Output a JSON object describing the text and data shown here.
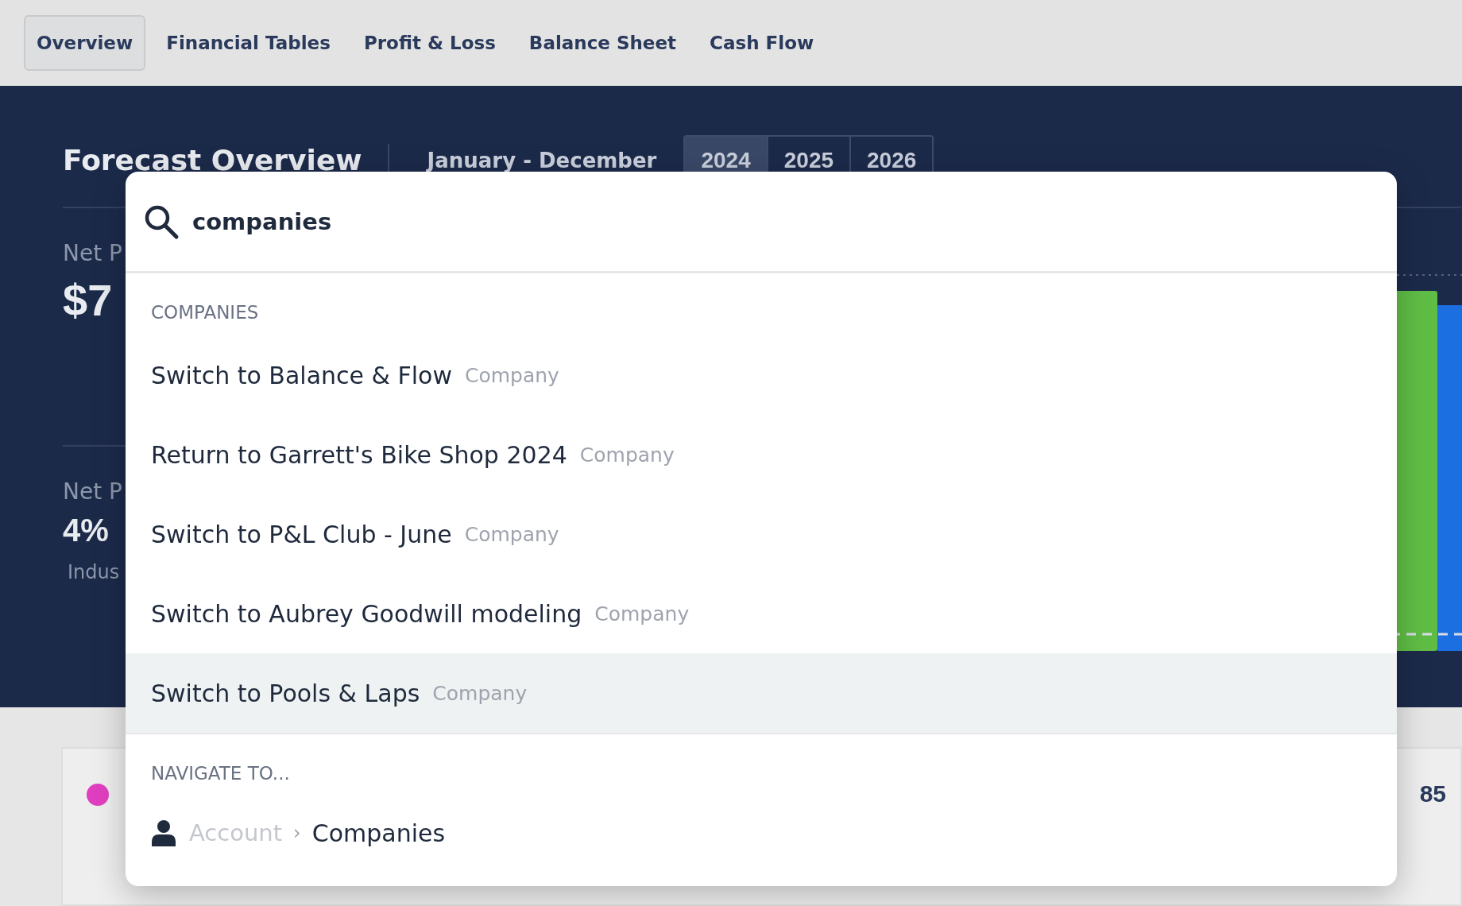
{
  "tabs": [
    {
      "label": "Overview",
      "selected": true
    },
    {
      "label": "Financial Tables",
      "selected": false
    },
    {
      "label": "Profit & Loss",
      "selected": false
    },
    {
      "label": "Balance Sheet",
      "selected": false
    },
    {
      "label": "Cash Flow",
      "selected": false
    }
  ],
  "forecast": {
    "title": "Forecast Overview",
    "period": "January - December",
    "years": [
      {
        "label": "2024",
        "selected": true
      },
      {
        "label": "2025",
        "selected": false
      },
      {
        "label": "2026",
        "selected": false
      }
    ]
  },
  "metrics": [
    {
      "label": "Net P",
      "value": "$7"
    },
    {
      "label": "Net P",
      "value": "4%",
      "note": "Indus"
    }
  ],
  "card": {
    "value": "85"
  },
  "palette": {
    "query": "companies",
    "sections": [
      {
        "heading": "COMPANIES",
        "items": [
          {
            "kind": "result",
            "title": "Switch to Balance & Flow",
            "type": "Company",
            "selected": false
          },
          {
            "kind": "result",
            "title": "Return to Garrett's Bike Shop 2024",
            "type": "Company",
            "selected": false
          },
          {
            "kind": "result",
            "title": "Switch to P&L Club - June",
            "type": "Company",
            "selected": false
          },
          {
            "kind": "result",
            "title": "Switch to Aubrey Goodwill modeling",
            "type": "Company",
            "selected": false
          },
          {
            "kind": "result",
            "title": "Switch to Pools & Laps",
            "type": "Company",
            "selected": true
          }
        ]
      },
      {
        "heading": "NAVIGATE TO...",
        "items": [
          {
            "kind": "breadcrumb",
            "parent": "Account",
            "separator": "›",
            "title": "Companies",
            "selected": false
          }
        ]
      }
    ]
  }
}
